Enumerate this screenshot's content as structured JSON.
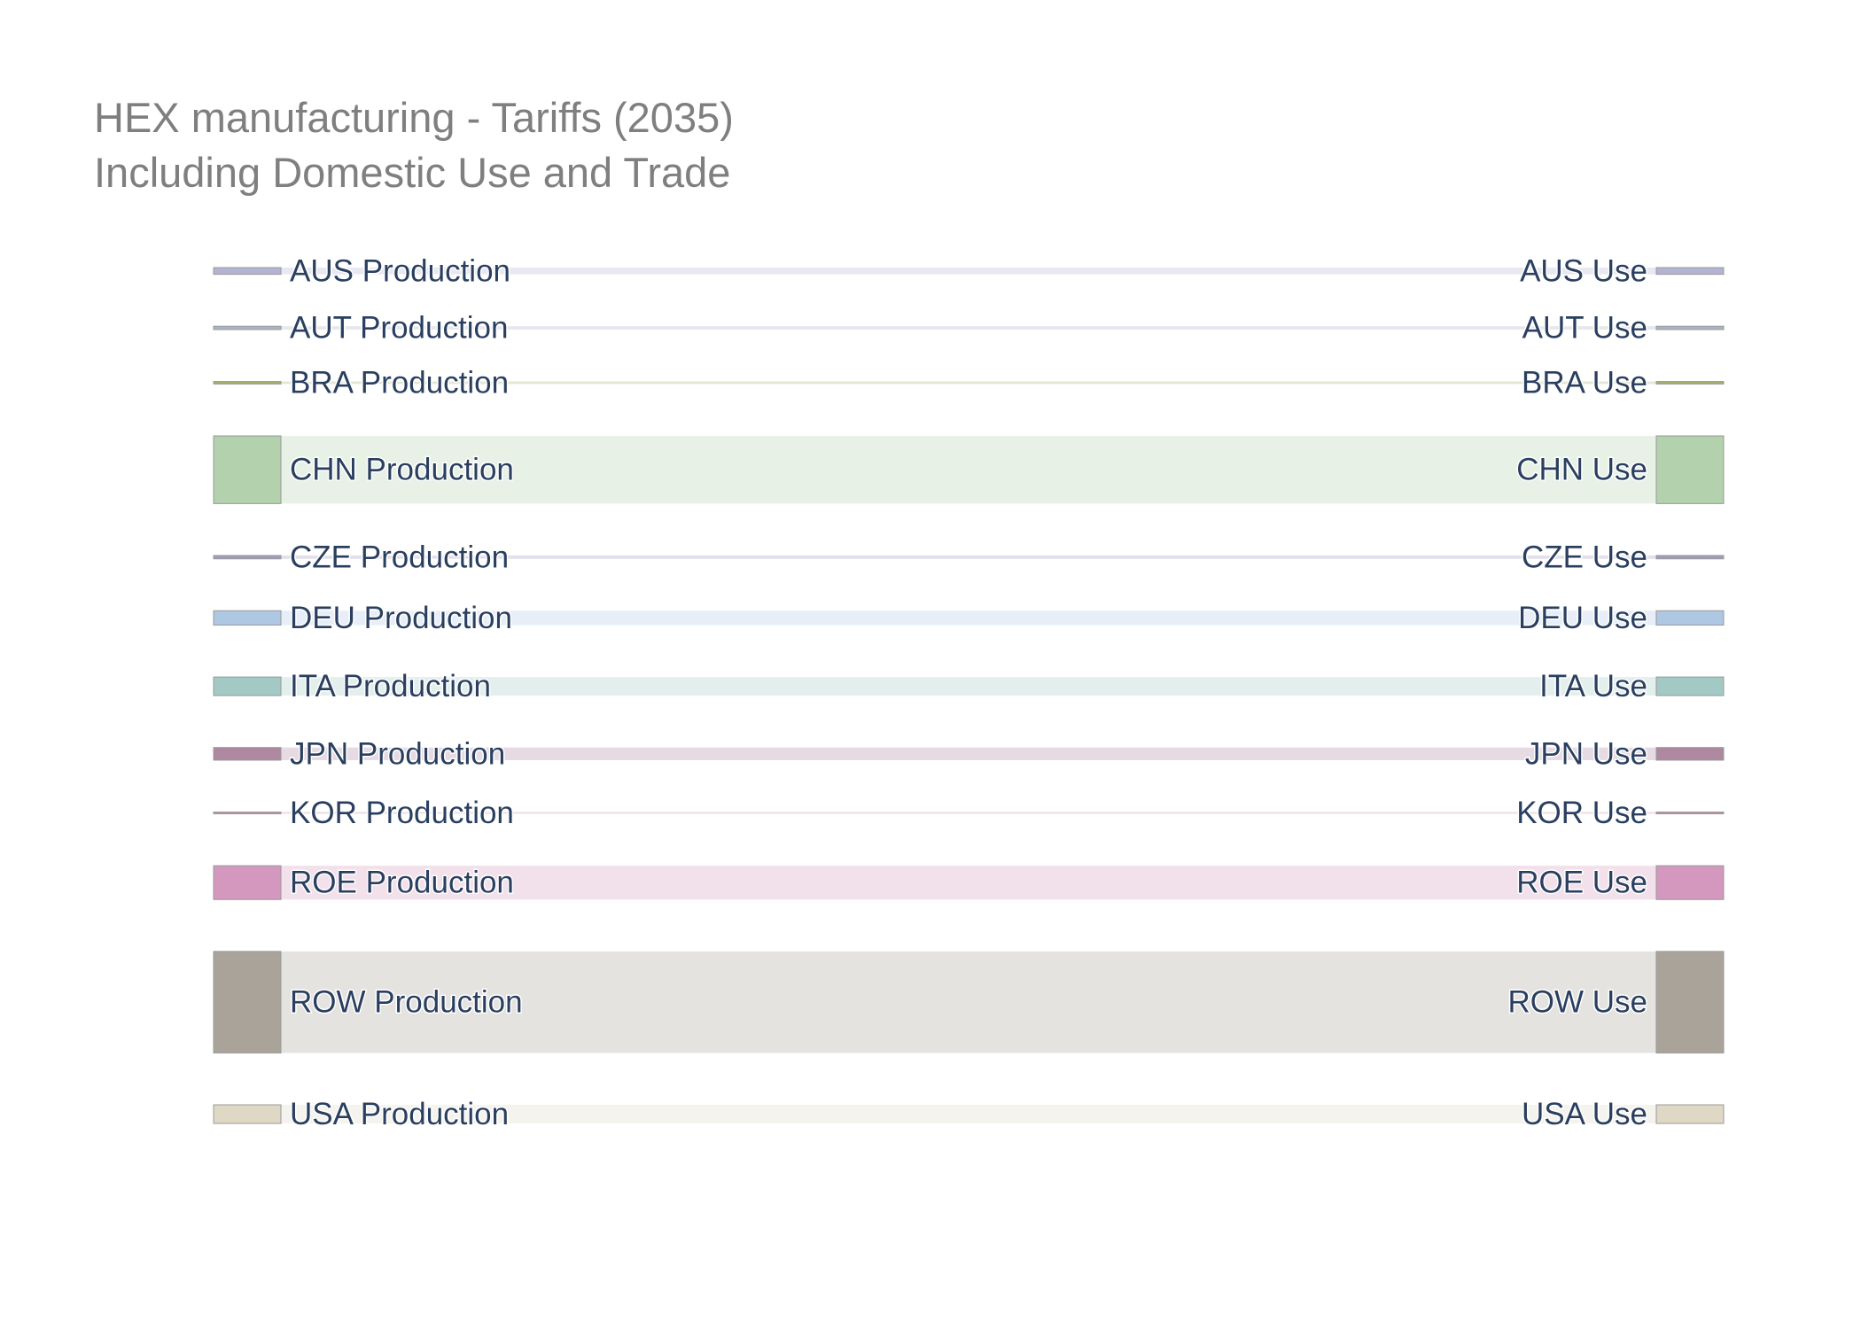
{
  "chart_data": {
    "type": "sankey",
    "title": "HEX manufacturing - Tariffs (2035)",
    "subtitle": "Including Domestic Use and Trade",
    "flows": [
      {
        "source": "AUS Production",
        "target": "AUS Use",
        "value": 0.4,
        "color": "#b3b3d4"
      },
      {
        "source": "AUT Production",
        "target": "AUT Use",
        "value": 0.2,
        "color": "#aab4c4"
      },
      {
        "source": "BRA Production",
        "target": "BRA Use",
        "value": 0.15,
        "color": "#a4b06c"
      },
      {
        "source": "CHN Production",
        "target": "CHN Use",
        "value": 4.0,
        "color": "#b3d1ac"
      },
      {
        "source": "CZE Production",
        "target": "CZE Use",
        "value": 0.2,
        "color": "#9f9bbd"
      },
      {
        "source": "DEU Production",
        "target": "DEU Use",
        "value": 0.85,
        "color": "#aec7e3"
      },
      {
        "source": "ITA Production",
        "target": "ITA Use",
        "value": 1.1,
        "color": "#a2c9c4"
      },
      {
        "source": "JPN Production",
        "target": "JPN Use",
        "value": 0.75,
        "color": "#ad889f"
      },
      {
        "source": "KOR Production",
        "target": "KOR Use",
        "value": 0.08,
        "color": "#c28da5"
      },
      {
        "source": "ROE Production",
        "target": "ROE Use",
        "value": 2.0,
        "color": "#d497be"
      },
      {
        "source": "ROW Production",
        "target": "ROW Use",
        "value": 6.0,
        "color": "#aaa399"
      },
      {
        "source": "USA Production",
        "target": "USA Use",
        "value": 1.1,
        "color": "#ded8c5"
      }
    ]
  }
}
